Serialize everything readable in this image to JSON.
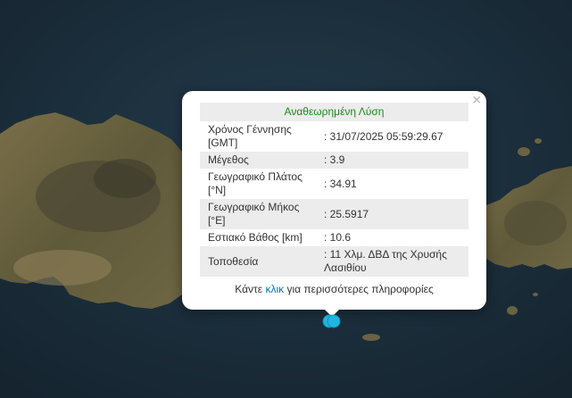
{
  "map": {
    "colors": {
      "sea": "#1b2f3d",
      "land": "#6a6240",
      "land_light": "#8c7e58",
      "mountain": "#4e4a34",
      "marker": "#1fb6e0"
    },
    "marker_icon": "earthquake-location-icon"
  },
  "popup": {
    "title": "Αναθεωρημένη Λύση",
    "close_symbol": "×",
    "rows": [
      {
        "label": "Χρόνος Γέννησης [GMT]",
        "value": ": 31/07/2025 05:59:29.67"
      },
      {
        "label": "Μέγεθος",
        "value": ": 3.9"
      },
      {
        "label": "Γεωγραφικό Πλάτος [°N]",
        "value": ": 34.91"
      },
      {
        "label": "Γεωγραφικό Μήκος [°E]",
        "value": ": 25.5917"
      },
      {
        "label": "Εστιακό Βάθος [km]",
        "value": ": 10.6"
      },
      {
        "label": "Τοποθεσία",
        "value": ": 11 Χλμ. ΔΒΔ της Χρυσής Λασιθίου"
      }
    ],
    "footer": {
      "prefix": "Κάντε ",
      "link": "κλικ",
      "suffix": " για περισσότερες πληροφορίες"
    }
  }
}
